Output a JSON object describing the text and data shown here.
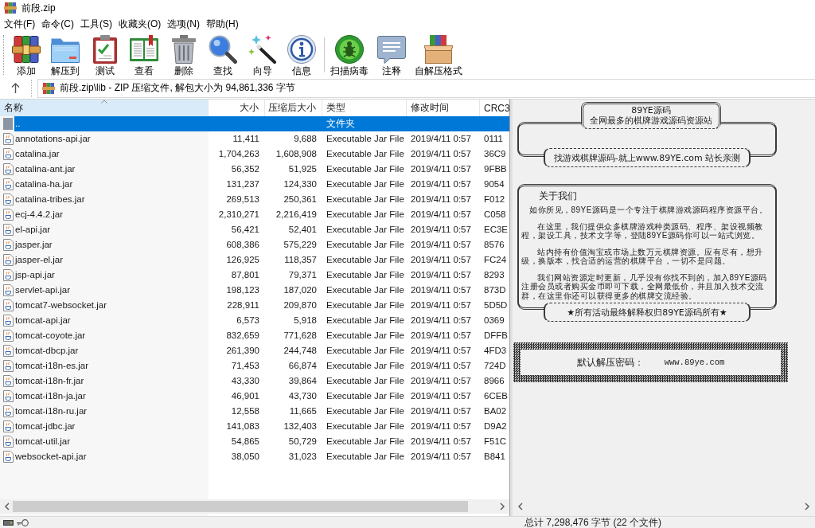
{
  "window": {
    "title": "前段.zip"
  },
  "menu": [
    "文件(F)",
    "命令(C)",
    "工具(S)",
    "收藏夹(O)",
    "选项(N)",
    "帮助(H)"
  ],
  "toolbar": {
    "groups": [
      [
        {
          "label": "添加"
        },
        {
          "label": "解压到"
        },
        {
          "label": "测试"
        },
        {
          "label": "查看"
        },
        {
          "label": "删除"
        },
        {
          "label": "查找"
        },
        {
          "label": "向导"
        },
        {
          "label": "信息"
        }
      ],
      [
        {
          "label": "扫描病毒"
        },
        {
          "label": "注释"
        },
        {
          "label": "自解压格式"
        }
      ]
    ]
  },
  "address_bar": {
    "path": "前段.zip\\lib - ZIP 压缩文件, 解包大小为 94,861,336 字节"
  },
  "file_list": {
    "columns": [
      {
        "label": "名称",
        "sorted": true
      },
      {
        "label": "大小",
        "sorted": false
      },
      {
        "label": "压缩后大小",
        "sorted": false
      },
      {
        "label": "类型",
        "sorted": false
      },
      {
        "label": "修改时间",
        "sorted": false
      },
      {
        "label": "CRC3",
        "sorted": false
      }
    ],
    "rows": [
      {
        "kind": "parent",
        "name": "..",
        "type": "文件夹",
        "selected": true
      },
      {
        "kind": "file",
        "name": "annotations-api.jar",
        "size": "11,411",
        "packed": "9,688",
        "type": "Executable Jar File",
        "modified": "2019/4/11 0:57",
        "crc": "0111",
        "selected": false
      },
      {
        "kind": "file",
        "name": "catalina.jar",
        "size": "1,704,263",
        "packed": "1,608,908",
        "type": "Executable Jar File",
        "modified": "2019/4/11 0:57",
        "crc": "36C9",
        "selected": false
      },
      {
        "kind": "file",
        "name": "catalina-ant.jar",
        "size": "56,352",
        "packed": "51,925",
        "type": "Executable Jar File",
        "modified": "2019/4/11 0:57",
        "crc": "9FBB",
        "selected": false
      },
      {
        "kind": "file",
        "name": "catalina-ha.jar",
        "size": "131,237",
        "packed": "124,330",
        "type": "Executable Jar File",
        "modified": "2019/4/11 0:57",
        "crc": "9054",
        "selected": false
      },
      {
        "kind": "file",
        "name": "catalina-tribes.jar",
        "size": "269,513",
        "packed": "250,361",
        "type": "Executable Jar File",
        "modified": "2019/4/11 0:57",
        "crc": "F012",
        "selected": false
      },
      {
        "kind": "file",
        "name": "ecj-4.4.2.jar",
        "size": "2,310,271",
        "packed": "2,216,419",
        "type": "Executable Jar File",
        "modified": "2019/4/11 0:57",
        "crc": "C058",
        "selected": false
      },
      {
        "kind": "file",
        "name": "el-api.jar",
        "size": "56,421",
        "packed": "52,401",
        "type": "Executable Jar File",
        "modified": "2019/4/11 0:57",
        "crc": "EC3E",
        "selected": false
      },
      {
        "kind": "file",
        "name": "jasper.jar",
        "size": "608,386",
        "packed": "575,229",
        "type": "Executable Jar File",
        "modified": "2019/4/11 0:57",
        "crc": "8576",
        "selected": false
      },
      {
        "kind": "file",
        "name": "jasper-el.jar",
        "size": "126,925",
        "packed": "118,357",
        "type": "Executable Jar File",
        "modified": "2019/4/11 0:57",
        "crc": "FC24",
        "selected": false
      },
      {
        "kind": "file",
        "name": "jsp-api.jar",
        "size": "87,801",
        "packed": "79,371",
        "type": "Executable Jar File",
        "modified": "2019/4/11 0:57",
        "crc": "8293",
        "selected": false
      },
      {
        "kind": "file",
        "name": "servlet-api.jar",
        "size": "198,123",
        "packed": "187,020",
        "type": "Executable Jar File",
        "modified": "2019/4/11 0:57",
        "crc": "873D",
        "selected": false
      },
      {
        "kind": "file",
        "name": "tomcat7-websocket.jar",
        "size": "228,911",
        "packed": "209,870",
        "type": "Executable Jar File",
        "modified": "2019/4/11 0:57",
        "crc": "5D5D",
        "selected": false
      },
      {
        "kind": "file",
        "name": "tomcat-api.jar",
        "size": "6,573",
        "packed": "5,918",
        "type": "Executable Jar File",
        "modified": "2019/4/11 0:57",
        "crc": "0369",
        "selected": false
      },
      {
        "kind": "file",
        "name": "tomcat-coyote.jar",
        "size": "832,659",
        "packed": "771,628",
        "type": "Executable Jar File",
        "modified": "2019/4/11 0:57",
        "crc": "DFFB",
        "selected": false
      },
      {
        "kind": "file",
        "name": "tomcat-dbcp.jar",
        "size": "261,390",
        "packed": "244,748",
        "type": "Executable Jar File",
        "modified": "2019/4/11 0:57",
        "crc": "4FD3",
        "selected": false
      },
      {
        "kind": "file",
        "name": "tomcat-i18n-es.jar",
        "size": "71,453",
        "packed": "66,874",
        "type": "Executable Jar File",
        "modified": "2019/4/11 0:57",
        "crc": "724D",
        "selected": false
      },
      {
        "kind": "file",
        "name": "tomcat-i18n-fr.jar",
        "size": "43,330",
        "packed": "39,864",
        "type": "Executable Jar File",
        "modified": "2019/4/11 0:57",
        "crc": "8966",
        "selected": false
      },
      {
        "kind": "file",
        "name": "tomcat-i18n-ja.jar",
        "size": "46,901",
        "packed": "43,730",
        "type": "Executable Jar File",
        "modified": "2019/4/11 0:57",
        "crc": "6CEB",
        "selected": false
      },
      {
        "kind": "file",
        "name": "tomcat-i18n-ru.jar",
        "size": "12,558",
        "packed": "11,665",
        "type": "Executable Jar File",
        "modified": "2019/4/11 0:57",
        "crc": "BA02",
        "selected": false
      },
      {
        "kind": "file",
        "name": "tomcat-jdbc.jar",
        "size": "141,083",
        "packed": "132,403",
        "type": "Executable Jar File",
        "modified": "2019/4/11 0:57",
        "crc": "D9A2",
        "selected": false
      },
      {
        "kind": "file",
        "name": "tomcat-util.jar",
        "size": "54,865",
        "packed": "50,729",
        "type": "Executable Jar File",
        "modified": "2019/4/11 0:57",
        "crc": "F51C",
        "selected": false
      },
      {
        "kind": "file",
        "name": "websocket-api.jar",
        "size": "38,050",
        "packed": "31,023",
        "type": "Executable Jar File",
        "modified": "2019/4/11 0:57",
        "crc": "B841",
        "selected": false
      }
    ]
  },
  "comment": {
    "banner": {
      "title": "89YE源码",
      "subtitle": "全网最多的棋牌游戏源码资源站",
      "tagline": "找游戏棋牌源码-就上www.89YE.com 站长亲测"
    },
    "about": {
      "heading": "关于我们",
      "paragraphs": [
        "如你所见，89YE源码是一个专注于棋牌游戏源码程序资源平台。",
        "在这里，我们提供众多棋牌游戏种类源码、程序、架设视频教程，架设工具，技术文字等，登陆89YE源码你可以一站式浏览。",
        "站内持有价值淘宝或市场上数万元棋牌资源。应有尽有，想升级，换版本，找合适的运营的棋牌平台，一切不是问题。",
        "我们网站资源定时更新，几乎没有你找不到的，加入89YE源码注册会员或者购买金币即可下载，全网最低价，并且加入技术交流群，在这里你还可以获得更多的棋牌交流经验。"
      ],
      "footer": "★所有活动最终解释权归89YE源码所有★"
    },
    "password": {
      "label": "默认解压密码：",
      "value": "www.89ye.com"
    }
  },
  "status_bar": {
    "summary": "总计 7,298,476 字节 (22 个文件)"
  }
}
